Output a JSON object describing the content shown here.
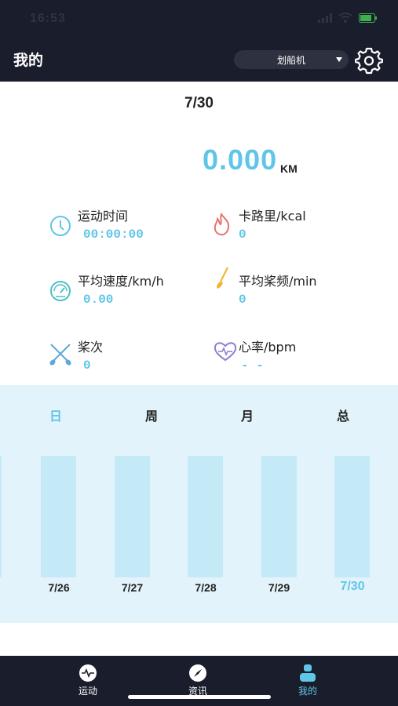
{
  "status_bar": {
    "time": "16:53"
  },
  "header": {
    "title": "我的",
    "device_select": "划船机"
  },
  "summary": {
    "date": "7/30",
    "distance_value": "0.000",
    "distance_unit": "KM"
  },
  "stats": [
    {
      "label": "运动时间",
      "value": "00:00:00",
      "icon": "clock-icon",
      "color": "#5fc6e8"
    },
    {
      "label": "卡路里/kcal",
      "value": "0",
      "icon": "flame-icon",
      "color": "#e8736b"
    },
    {
      "label": "平均速度/km/h",
      "value": "0.00",
      "icon": "speedometer-icon",
      "color": "#4fc0c8"
    },
    {
      "label": "平均桨频/min",
      "value": "0",
      "icon": "paddle-icon",
      "color": "#f0b429"
    },
    {
      "label": "桨次",
      "value": "0",
      "icon": "crossed-oars-icon",
      "color": "#5fa8d8"
    },
    {
      "label": "心率/bpm",
      "value": "- -",
      "icon": "heart-rate-icon",
      "color": "#8b7fd6"
    }
  ],
  "chart": {
    "tabs": [
      "日",
      "周",
      "月",
      "总"
    ],
    "active_tab": "日"
  },
  "chart_data": {
    "type": "bar",
    "categories": [
      "7/26",
      "7/27",
      "7/28",
      "7/29",
      "7/30"
    ],
    "values": [
      0,
      0,
      0,
      0,
      0
    ],
    "highlighted": "7/30"
  },
  "tabbar": {
    "items": [
      {
        "label": "运动",
        "icon": "activity-icon"
      },
      {
        "label": "资讯",
        "icon": "compass-icon"
      },
      {
        "label": "我的",
        "icon": "user-icon"
      }
    ],
    "active": "我的"
  },
  "colors": {
    "accent": "#5fc6e8",
    "header_bg": "#1a1d2b",
    "chart_bg": "#e2f3fb",
    "bar": "#c4eaf7"
  }
}
